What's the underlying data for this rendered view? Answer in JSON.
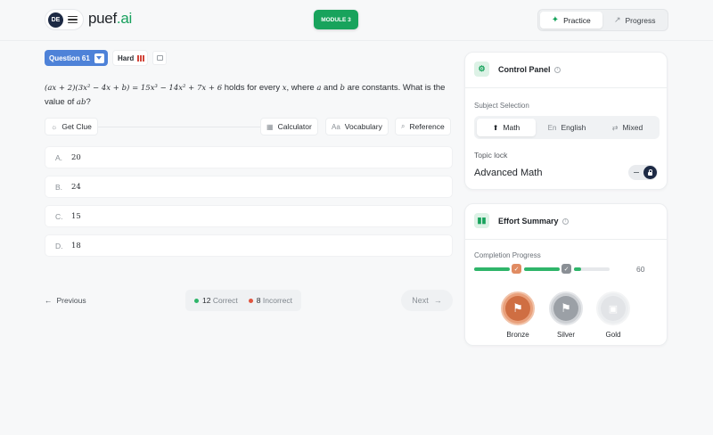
{
  "header": {
    "avatar_initials": "DE",
    "logo_main": "puef",
    "logo_suffix": ".ai",
    "module_label": "MODULE 3",
    "modes": [
      {
        "label": "Practice",
        "icon": "sparkle-icon",
        "active": true
      },
      {
        "label": "Progress",
        "icon": "trend-up-icon",
        "active": false
      }
    ]
  },
  "question": {
    "number_label": "Question 61",
    "difficulty": "Hard",
    "text_prefix": "(ax + 2)(3x² − 4x + b) = 15x³ − 14x² + 7x + 6",
    "text_mid1": " holds for every ",
    "var_x": "x",
    "text_mid2": ", where ",
    "var_a": "a",
    "text_mid3": " and ",
    "var_b": "b",
    "text_mid4": " are constants. What is the value of ",
    "var_ab": "ab",
    "text_end": "?"
  },
  "tools": {
    "clue": "Get Clue",
    "calculator": "Calculator",
    "vocabulary": "Vocabulary",
    "reference": "Reference"
  },
  "choices": [
    {
      "letter": "A.",
      "value": "20"
    },
    {
      "letter": "B.",
      "value": "24"
    },
    {
      "letter": "C.",
      "value": "15"
    },
    {
      "letter": "D.",
      "value": "18"
    }
  ],
  "footer": {
    "previous": "Previous",
    "correct_count": "12",
    "correct_label": "Correct",
    "incorrect_count": "8",
    "incorrect_label": "Incorrect",
    "next": "Next"
  },
  "control_panel": {
    "title": "Control Panel",
    "subject_label": "Subject Selection",
    "subjects": [
      {
        "label": "Math",
        "active": true
      },
      {
        "label": "English",
        "active": false
      },
      {
        "label": "Mixed",
        "active": false
      }
    ],
    "topic_lock_label": "Topic lock",
    "topic_value": "Advanced Math"
  },
  "effort_summary": {
    "title": "Effort Summary",
    "progress_label": "Completion Progress",
    "progress_value": "60",
    "progress_fraction": 0.6,
    "medals": [
      {
        "label": "Bronze",
        "achieved": true
      },
      {
        "label": "Silver",
        "achieved": true
      },
      {
        "label": "Gold",
        "achieved": false
      }
    ]
  },
  "colors": {
    "accent_green": "#18a35c",
    "question_blue": "#4e82d8",
    "difficulty_red": "#d2463a",
    "bronze": "#e08b62",
    "silver": "#bfc3c8",
    "navy": "#1d2a44"
  }
}
